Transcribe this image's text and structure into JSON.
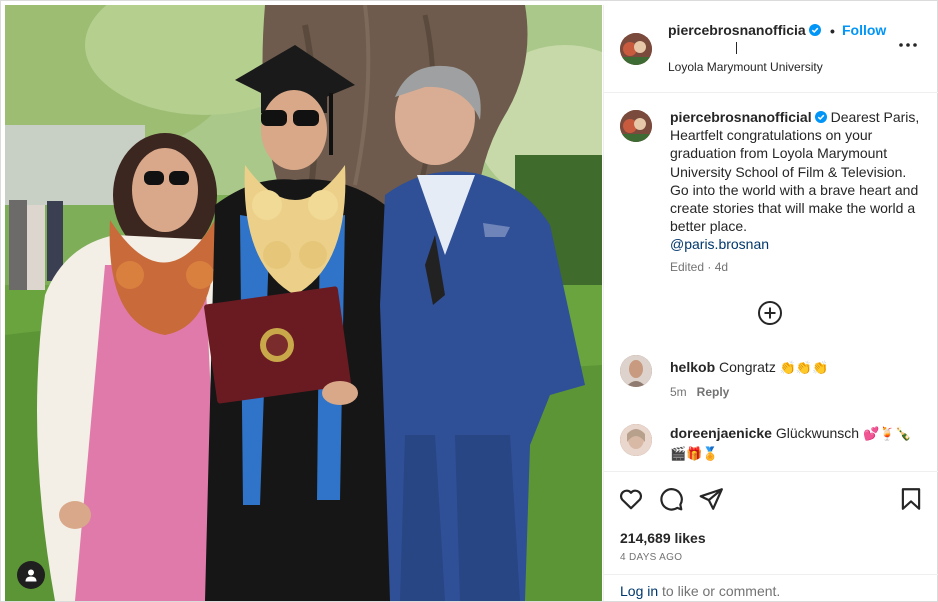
{
  "post": {
    "username": "piercebrosnanofficia",
    "username_full": "piercebrosnanofficial",
    "separator": "•",
    "follow_label": "Follow",
    "location": "Loyola Marymount University"
  },
  "caption": {
    "text": "Dearest Paris, Heartfelt congratulations on your graduation from Loyola Marymount University School of Film & Television. Go into the world with a brave heart and create stories that will make the world a better place.",
    "mention": "@paris.brosnan",
    "edited": "Edited",
    "dot": "·",
    "time": "4d"
  },
  "comments": [
    {
      "username": "helkob",
      "text": "Congratz",
      "emoji": "👏👏👏",
      "time": "5m",
      "reply_label": "Reply"
    },
    {
      "username": "doreenjaenicke",
      "text": "Glückwunsch",
      "emoji": "💕🍹🍾🎬🎁🏅"
    }
  ],
  "stats": {
    "likes": "214,689 likes",
    "ago": "4 DAYS AGO"
  },
  "login": {
    "link": "Log in",
    "rest": " to like or comment."
  },
  "colors": {
    "link_blue": "#0095f6",
    "mention_blue": "#00376b",
    "verified_blue": "#0095f6",
    "muted": "#737373"
  },
  "icons": [
    "user-tag-icon",
    "verified-badge-icon",
    "more-options-icon",
    "add-comment-icon",
    "heart-icon",
    "comment-icon",
    "share-icon",
    "bookmark-icon"
  ]
}
